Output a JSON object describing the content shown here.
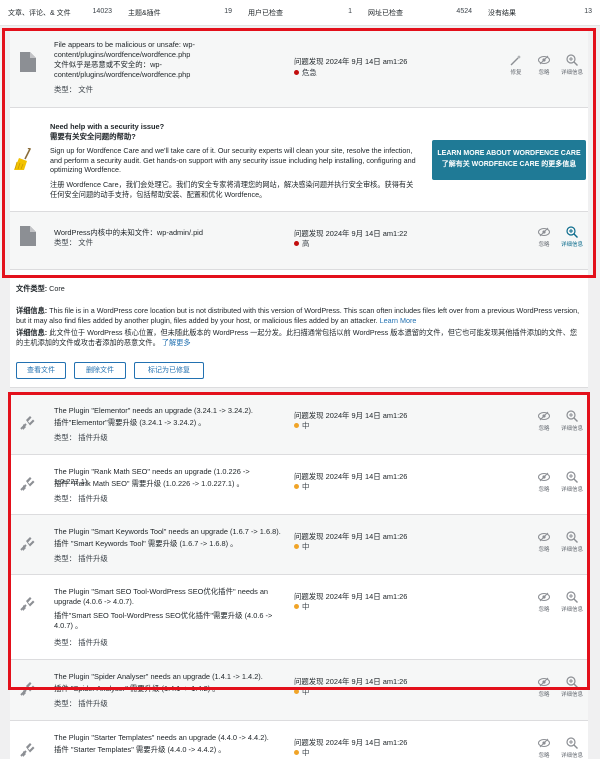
{
  "stats": [
    {
      "label": "文章、评论、& 文件",
      "value": "14023"
    },
    {
      "label": "主题&插件",
      "value": "19"
    },
    {
      "label": "用户已检查",
      "value": "1"
    },
    {
      "label": "网址已检查",
      "value": "4524"
    },
    {
      "label": "没有结果",
      "value": "13"
    }
  ],
  "issue1": {
    "title_en": "File appears to be malicious or unsafe: wp-content/plugins/wordfence/wordfence.php",
    "title_zh": "文件似乎是恶意或不安全的：wp-content/plugins/wordfence/wordfence.php",
    "type": "类型：  文件",
    "found": "问题发现 2024年 9月 14日 am1:26",
    "severity": "危急",
    "actions": {
      "repair": "修复",
      "ignore": "忽略",
      "details": "详细信息"
    }
  },
  "care": {
    "heading_en": "Need help with a security issue?",
    "heading_zh": "需要有关安全问题的帮助?",
    "body_en": "Sign up for Wordfence Care and we'll take care of it. Our security experts will clean your site, resolve the infection, and perform a security audit. Get hands-on support with any security issue including help installing, configuring and optimizing Wordfence.",
    "body_zh": "注册 Wordfence Care，我们会处理它。我们的安全专家将清理您的网站，解决感染问题并执行安全审核。获得有关任何安全问题的动手支持，包括帮助安装、配置和优化 Wordfence。",
    "button_en": "LEARN MORE ABOUT WORDFENCE CARE",
    "button_zh": "了解有关 WORDFENCE CARE 的更多信息"
  },
  "issue2": {
    "title": "WordPress内核中的未知文件：wp-admin/.pid",
    "type": "类型：  文件",
    "found": "问题发现 2024年 9月 14日 am1:22",
    "severity": "高",
    "actions": {
      "ignore": "忽略",
      "details": "详细信息"
    }
  },
  "detail": {
    "file_label": "文件类型:",
    "file_value": "Core",
    "info_label": "详细信息:",
    "info_en": "This file is in a WordPress core location but is not distributed with this version of WordPress. This scan often includes files left over from a previous WordPress version, but it may also find files added by another plugin, files added by your host, or malicious files added by an attacker.",
    "learn_more_en": "Learn More",
    "info_zh_label": "详细信息:",
    "info_zh": "此文件位于 WordPress 核心位置，但未随此版本的 WordPress 一起分发。此扫描通常包括以前 WordPress 版本遗留的文件，但它也可能发现其他插件添加的文件、您的主机添加的文件或攻击者添加的恶意文件。",
    "learn_more_zh": "了解更多",
    "buttons": {
      "view": "查看文件",
      "delete": "删除文件",
      "mark": "标记为已修复"
    }
  },
  "plugins": [
    {
      "en": "The Plugin \"Elementor\" needs an upgrade (3.24.1 -> 3.24.2).",
      "zh": "插件\"Elementor\"需要升级  (3.24.1 -> 3.24.2) 。",
      "type": "类型：  插件升级",
      "found": "问题发现 2024年 9月 14日 am1:26",
      "sev": "中"
    },
    {
      "en": "The Plugin \"Rank Math SEO\" needs an upgrade (1.0.226 -> 1.0.227.1).",
      "zh": "插件 \"Rank Math SEO\" 需要升级  (1.0.226 -> 1.0.227.1) 。",
      "type": "类型：  插件升级",
      "found": "问题发现 2024年 9月 14日 am1:26",
      "sev": "中"
    },
    {
      "en": "The Plugin \"Smart Keywords Tool\" needs an upgrade (1.6.7 -> 1.6.8).",
      "zh": "插件 \"Smart Keywords Tool\" 需要升级  (1.6.7 -> 1.6.8) 。",
      "type": "类型：  插件升级",
      "found": "问题发现 2024年 9月 14日 am1:26",
      "sev": "中"
    },
    {
      "en": "The Plugin \"Smart SEO Tool-WordPress SEO优化插件\" needs an upgrade (4.0.6 -> 4.0.7).",
      "zh": "插件\"Smart SEO Tool-WordPress SEO优化插件\"需要升级  (4.0.6 -> 4.0.7) 。",
      "type": "类型：  插件升级",
      "found": "问题发现 2024年 9月 14日 am1:26",
      "sev": "中"
    },
    {
      "en": "The Plugin \"Spider Analyser\" needs an upgrade (1.4.1 -> 1.4.2).",
      "zh": "插件 \"Spider Analyser\" 需要升级  (1.4.1 -> 1.4.2) 。",
      "type": "类型：  插件升级",
      "found": "问题发现 2024年 9月 14日 am1:26",
      "sev": "中"
    },
    {
      "en": "The Plugin \"Starter Templates\" needs an upgrade (4.4.0 -> 4.4.2).",
      "zh": "插件 \"Starter Templates\" 需要升级  (4.4.0 -> 4.4.2) 。",
      "type": "",
      "found": "问题发现 2024年 9月 14日 am1:26",
      "sev": "中"
    }
  ],
  "plugin_actions": {
    "ignore": "忽略",
    "details": "详细信息"
  },
  "colors": {
    "highlight": "#e3101b",
    "accent": "#1f7a96",
    "critical": "#c20d0d",
    "medium": "#f0a428"
  }
}
